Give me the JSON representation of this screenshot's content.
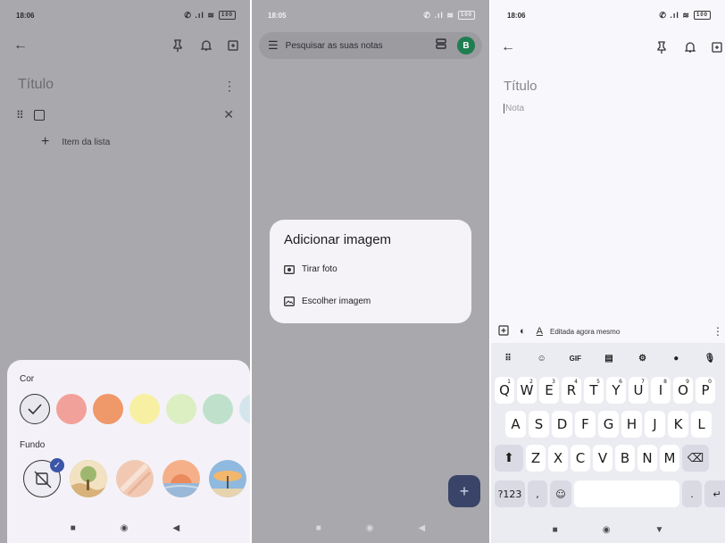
{
  "panel_left": {
    "status_time": "18:06",
    "battery": "100",
    "title_placeholder": "Título",
    "add_item_label": "Item da lista",
    "color_sheet": {
      "color_label": "Cor",
      "background_label": "Fundo",
      "colors": [
        "#e8e8ee",
        "#f2a19a",
        "#ef9869",
        "#f7f0a3",
        "#dbefc3",
        "#bfe1cb",
        "#d4e6ec"
      ],
      "selected_color_index": 0,
      "backgrounds": [
        "none",
        "grocery",
        "food",
        "music",
        "travel"
      ],
      "selected_background_index": 0
    }
  },
  "panel_middle": {
    "status_time": "18:05",
    "battery": "100",
    "search_placeholder": "Pesquisar as suas notas",
    "avatar_letter": "B",
    "dialog": {
      "title": "Adicionar imagem",
      "options": [
        "Tirar foto",
        "Escolher imagem"
      ]
    },
    "fab_label": "+"
  },
  "panel_right": {
    "status_time": "18:06",
    "battery": "100",
    "title_placeholder": "Título",
    "note_placeholder": "Nota",
    "edited_text": "Editada agora mesmo",
    "keyboard": {
      "row1": [
        [
          "Q",
          "1"
        ],
        [
          "W",
          "2"
        ],
        [
          "E",
          "3"
        ],
        [
          "R",
          "4"
        ],
        [
          "T",
          "5"
        ],
        [
          "Y",
          "6"
        ],
        [
          "U",
          "7"
        ],
        [
          "I",
          "8"
        ],
        [
          "O",
          "9"
        ],
        [
          "P",
          "0"
        ]
      ],
      "row2": [
        "A",
        "S",
        "D",
        "F",
        "G",
        "H",
        "J",
        "K",
        "L"
      ],
      "row3": [
        "Z",
        "X",
        "C",
        "V",
        "B",
        "N",
        "M"
      ],
      "gif_label": "GIF",
      "symbols_label": "?123",
      "comma": ",",
      "period": "."
    }
  }
}
